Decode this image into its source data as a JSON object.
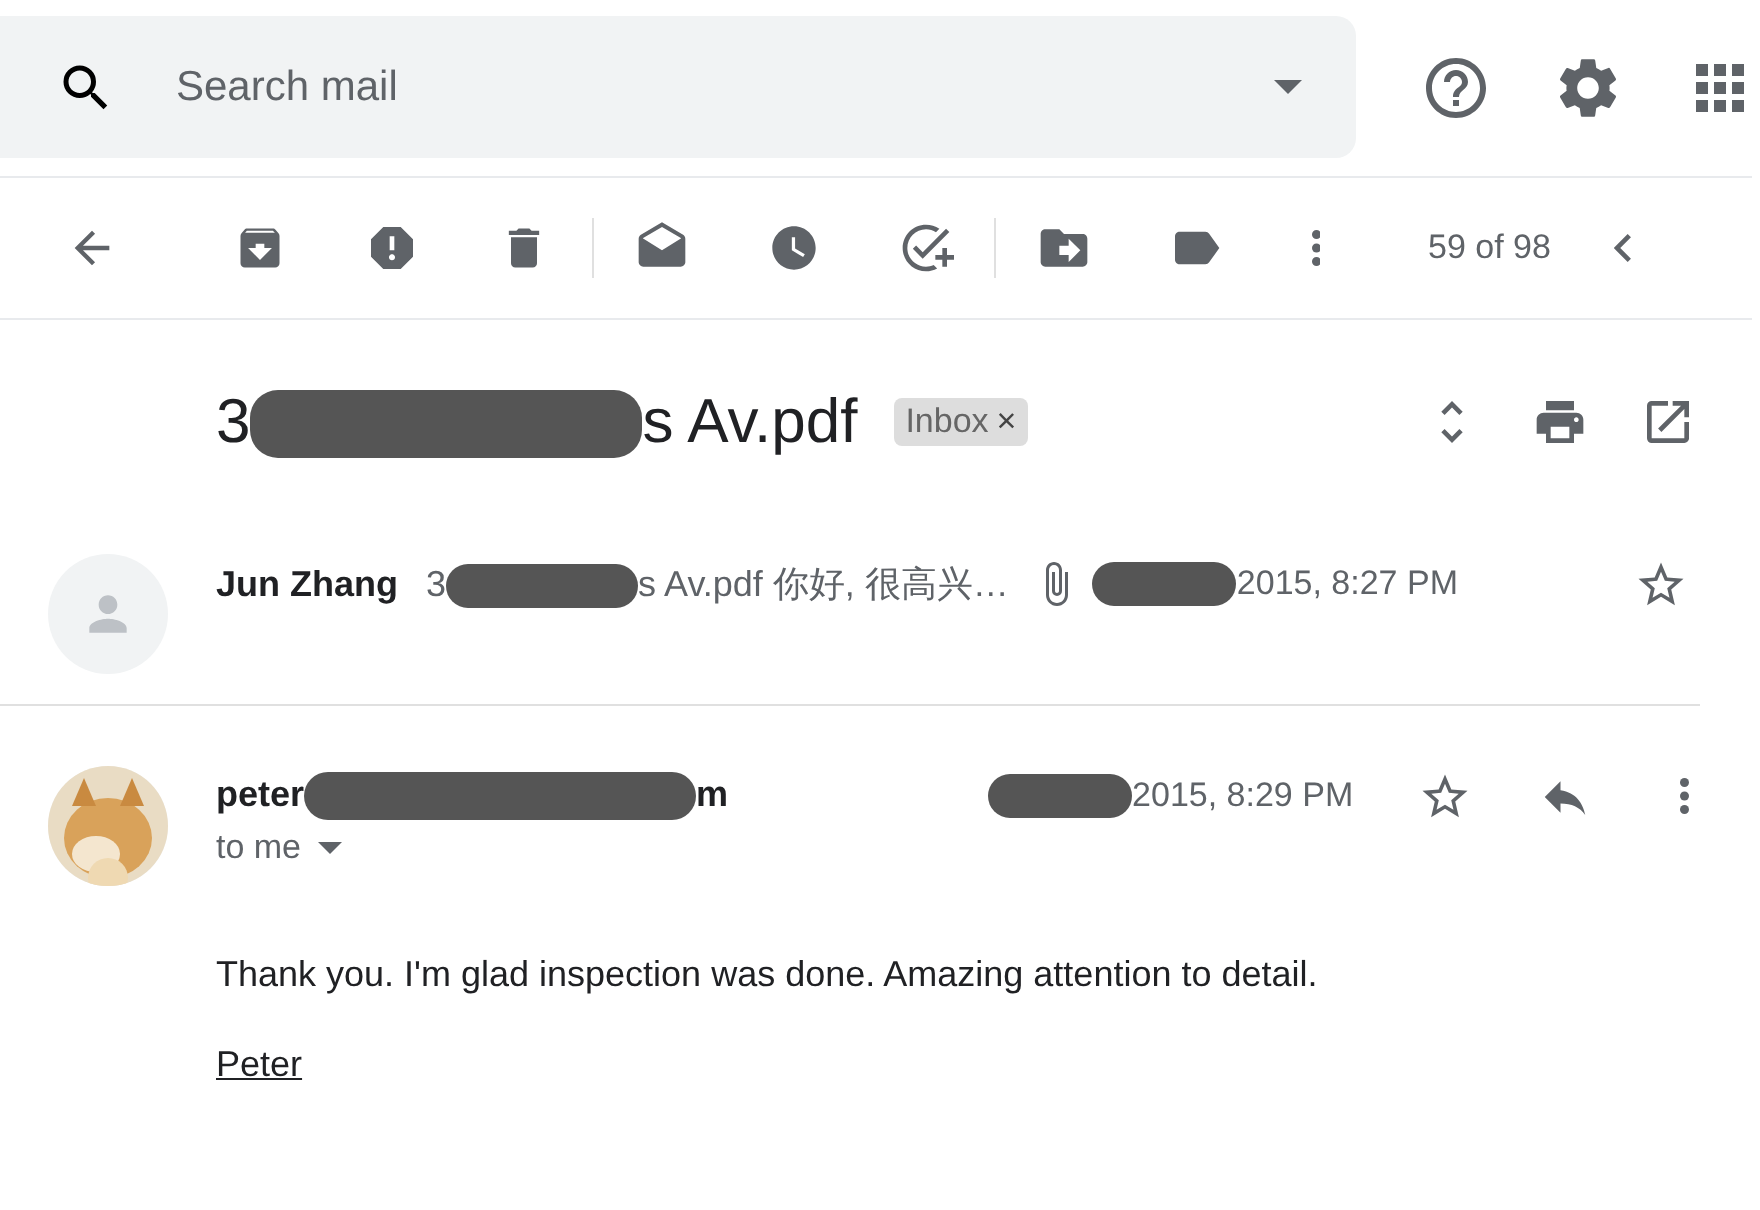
{
  "search": {
    "placeholder": "Search mail"
  },
  "toolbar": {
    "counter": "59 of 98"
  },
  "thread": {
    "subject_parts": [
      "3",
      "s Av.pdf"
    ],
    "label": "Inbox",
    "label_close": "×"
  },
  "messages": [
    {
      "kind": "collapsed",
      "avatar": {
        "kind": "placeholder"
      },
      "sender": "Jun Zhang",
      "snippet_parts": [
        "3",
        "s Av.pdf 你好, 很高兴…"
      ],
      "has_attachment": true,
      "date": "2015, 8:27 PM",
      "starred": false
    },
    {
      "kind": "expanded",
      "sender_parts": [
        "peter",
        "m"
      ],
      "recipient": "to me",
      "date": "2015, 8:29 PM",
      "starred": false,
      "body": "Thank you. I'm glad inspection was done. Amazing attention to detail.",
      "signature": "Peter"
    }
  ]
}
